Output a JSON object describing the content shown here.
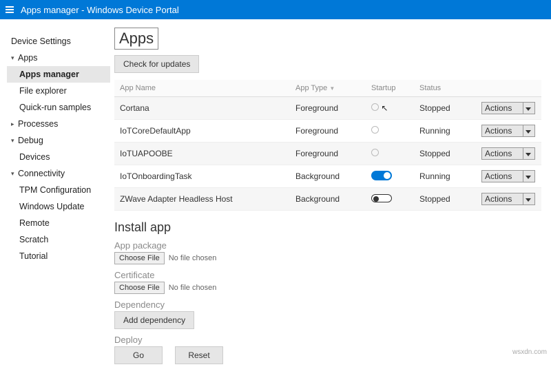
{
  "header": {
    "title": "Apps manager - Windows Device Portal"
  },
  "sidebar": {
    "items": [
      {
        "label": "Device Settings",
        "kind": "top"
      },
      {
        "label": "Apps",
        "kind": "top",
        "open": true
      },
      {
        "label": "Apps manager",
        "kind": "sub",
        "selected": true
      },
      {
        "label": "File explorer",
        "kind": "sub"
      },
      {
        "label": "Quick-run samples",
        "kind": "sub"
      },
      {
        "label": "Processes",
        "kind": "top",
        "caret": true
      },
      {
        "label": "Debug",
        "kind": "top",
        "open": true
      },
      {
        "label": "Devices",
        "kind": "sub"
      },
      {
        "label": "Connectivity",
        "kind": "top",
        "open": true
      },
      {
        "label": "TPM Configuration",
        "kind": "sub"
      },
      {
        "label": "Windows Update",
        "kind": "sub"
      },
      {
        "label": "Remote",
        "kind": "sub"
      },
      {
        "label": "Scratch",
        "kind": "sub"
      },
      {
        "label": "Tutorial",
        "kind": "sub"
      }
    ]
  },
  "page": {
    "title": "Apps",
    "check_updates": "Check for updates",
    "table": {
      "headers": {
        "name": "App Name",
        "type": "App Type",
        "startup": "Startup",
        "status": "Status"
      },
      "actions_label": "Actions",
      "rows": [
        {
          "name": "Cortana",
          "type": "Foreground",
          "startup": "radio",
          "status": "Stopped"
        },
        {
          "name": "IoTCoreDefaultApp",
          "type": "Foreground",
          "startup": "radio",
          "status": "Running"
        },
        {
          "name": "IoTUAPOOBE",
          "type": "Foreground",
          "startup": "radio",
          "status": "Stopped"
        },
        {
          "name": "IoTOnboardingTask",
          "type": "Background",
          "startup": "toggle-on",
          "status": "Running"
        },
        {
          "name": "ZWave Adapter Headless Host",
          "type": "Background",
          "startup": "toggle-off",
          "status": "Stopped"
        }
      ]
    },
    "install": {
      "heading": "Install app",
      "package_label": "App package",
      "certificate_label": "Certificate",
      "dependency_label": "Dependency",
      "deploy_label": "Deploy",
      "choose_file": "Choose File",
      "no_file": "No file chosen",
      "add_dependency": "Add dependency",
      "go": "Go",
      "reset": "Reset"
    }
  },
  "watermark": "wsxdn.com"
}
